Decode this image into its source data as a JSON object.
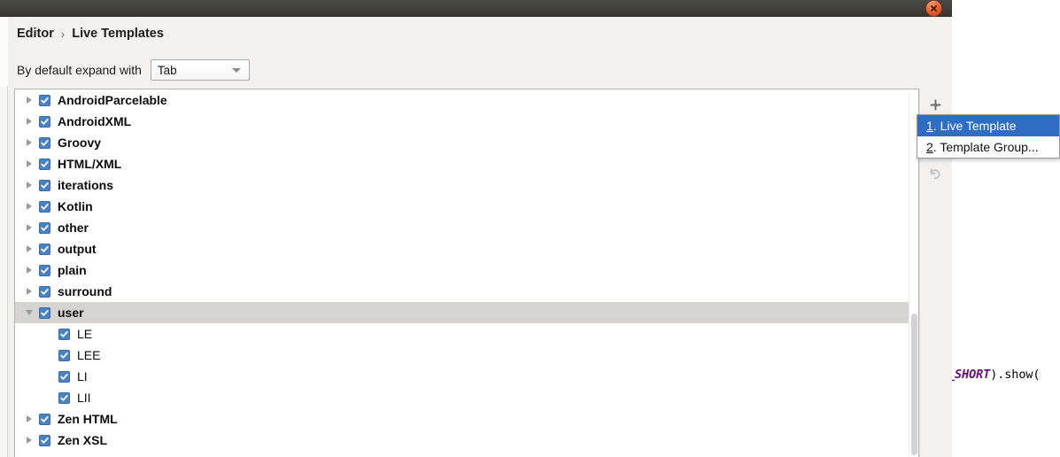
{
  "window": {
    "close_icon": "close-icon"
  },
  "breadcrumb": {
    "root": "Editor",
    "separator": "›",
    "current": "Live Templates"
  },
  "settings": {
    "expand_label": "By default expand with",
    "expand_value": "Tab",
    "expand_arrow_icon": "chevron-down-icon"
  },
  "tree": {
    "items": [
      {
        "label": "AndroidParcelable",
        "level": 0,
        "expanded": false,
        "checked": true,
        "selected": false
      },
      {
        "label": "AndroidXML",
        "level": 0,
        "expanded": false,
        "checked": true,
        "selected": false
      },
      {
        "label": "Groovy",
        "level": 0,
        "expanded": false,
        "checked": true,
        "selected": false
      },
      {
        "label": "HTML/XML",
        "level": 0,
        "expanded": false,
        "checked": true,
        "selected": false
      },
      {
        "label": "iterations",
        "level": 0,
        "expanded": false,
        "checked": true,
        "selected": false
      },
      {
        "label": "Kotlin",
        "level": 0,
        "expanded": false,
        "checked": true,
        "selected": false
      },
      {
        "label": "other",
        "level": 0,
        "expanded": false,
        "checked": true,
        "selected": false
      },
      {
        "label": "output",
        "level": 0,
        "expanded": false,
        "checked": true,
        "selected": false
      },
      {
        "label": "plain",
        "level": 0,
        "expanded": false,
        "checked": true,
        "selected": false
      },
      {
        "label": "surround",
        "level": 0,
        "expanded": false,
        "checked": true,
        "selected": false
      },
      {
        "label": "user",
        "level": 0,
        "expanded": true,
        "checked": true,
        "selected": true
      },
      {
        "label": "LE",
        "level": 1,
        "expanded": false,
        "checked": true,
        "selected": false
      },
      {
        "label": "LEE",
        "level": 1,
        "expanded": false,
        "checked": true,
        "selected": false
      },
      {
        "label": "LI",
        "level": 1,
        "expanded": false,
        "checked": true,
        "selected": false
      },
      {
        "label": "LII",
        "level": 1,
        "expanded": false,
        "checked": true,
        "selected": false
      },
      {
        "label": "Zen HTML",
        "level": 0,
        "expanded": false,
        "checked": true,
        "selected": false
      },
      {
        "label": "Zen XSL",
        "level": 0,
        "expanded": false,
        "checked": true,
        "selected": false
      }
    ]
  },
  "toolbar": {
    "add_icon": "plus-icon",
    "undo_icon": "undo-arrow-icon"
  },
  "popup_menu": {
    "items": [
      {
        "mnemonic": "1",
        "label": ". Live Template",
        "selected": true
      },
      {
        "mnemonic": "2",
        "label": ". Template Group...",
        "selected": false
      }
    ]
  },
  "editor": {
    "code_constant": "H_SHORT",
    "code_tail": ").show("
  },
  "colors": {
    "selection_blue": "#2f6cc4",
    "checkbox_blue": "#4a83c5",
    "row_selected_grey": "#d6d4d0",
    "titlebar_dark": "#403f3c",
    "close_red": "#e8643a",
    "code_purple": "#660e7a"
  }
}
